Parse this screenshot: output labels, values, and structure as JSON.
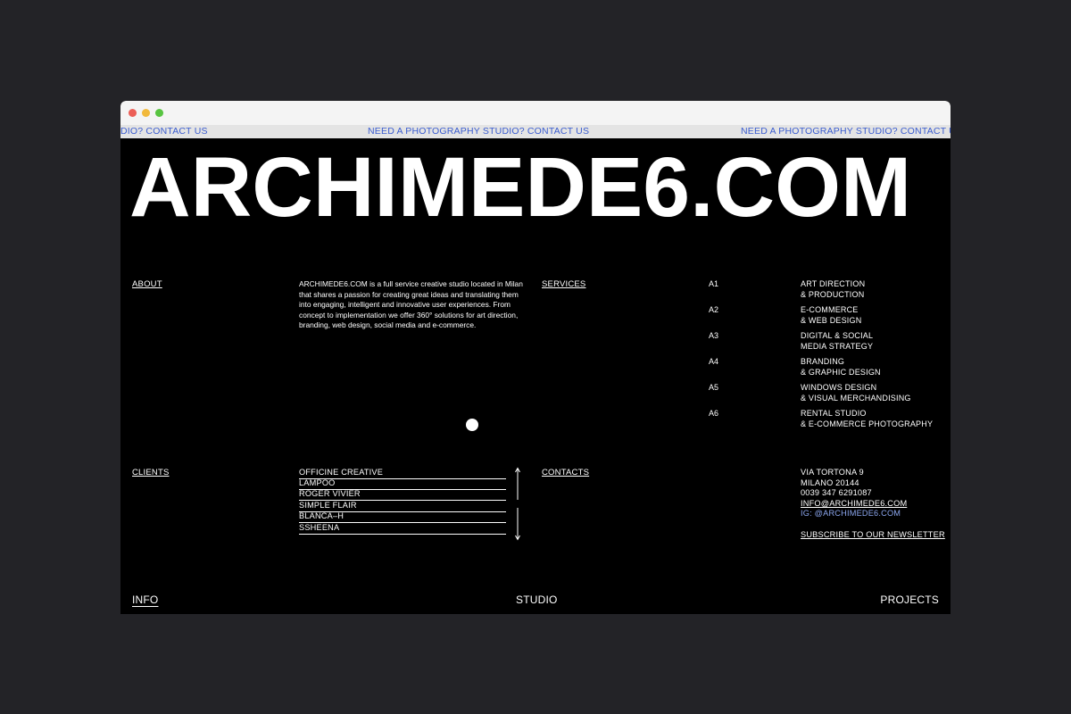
{
  "ticker": {
    "item1": "DIO? CONTACT US",
    "item2": "NEED A PHOTOGRAPHY STUDIO? CONTACT US",
    "item3": "NEED A PHOTOGRAPHY STUDIO? CONTACT US"
  },
  "hero_title": "ARCHIMEDE6.COM",
  "about": {
    "label": "ABOUT",
    "text": "ARCHIMEDE6.COM is a full service creative studio located in Milan that shares a passion for creating great ideas and translating them into engaging, intelligent and innovative user experiences. From concept to implementation we offer 360° solutions for art direction, branding, web design, social media and e-commerce."
  },
  "services": {
    "label": "SERVICES",
    "items": [
      {
        "code": "A1",
        "line1": "ART DIRECTION",
        "line2": "& PRODUCTION"
      },
      {
        "code": "A2",
        "line1": "E-COMMERCE",
        "line2": "& WEB DESIGN"
      },
      {
        "code": "A3",
        "line1": "DIGITAL & SOCIAL",
        "line2": "MEDIA STRATEGY"
      },
      {
        "code": "A4",
        "line1": "BRANDING",
        "line2": "& GRAPHIC DESIGN"
      },
      {
        "code": "A5",
        "line1": "WINDOWS DESIGN",
        "line2": "& VISUAL MERCHANDISING"
      },
      {
        "code": "A6",
        "line1": "RENTAL STUDIO",
        "line2": "& E-COMMERCE PHOTOGRAPHY"
      }
    ]
  },
  "clients": {
    "label": "CLIENTS",
    "items": [
      "OFFICINE CREATIVE",
      "LAMPOO",
      "ROGER VIVIER",
      "SIMPLE FLAIR",
      "BLANCA–H",
      "SSHEENA"
    ]
  },
  "contacts": {
    "label": "CONTACTS",
    "address1": "VIA TORTONA 9",
    "address2": "MILANO 20144",
    "phone": "0039 347 6291087",
    "email": "INFO@ARCHIMEDE6.COM",
    "instagram": "IG: @ARCHIMEDE6.COM",
    "newsletter": "SUBSCRIBE TO OUR NEWSLETTER"
  },
  "nav": {
    "info": "INFO",
    "studio": "STUDIO",
    "projects": "PROJECTS"
  },
  "colors": {
    "background": "#000000",
    "ticker_text": "#3a5ccf",
    "ticker_bg": "#e4e4e4",
    "page_bg": "#232327"
  }
}
